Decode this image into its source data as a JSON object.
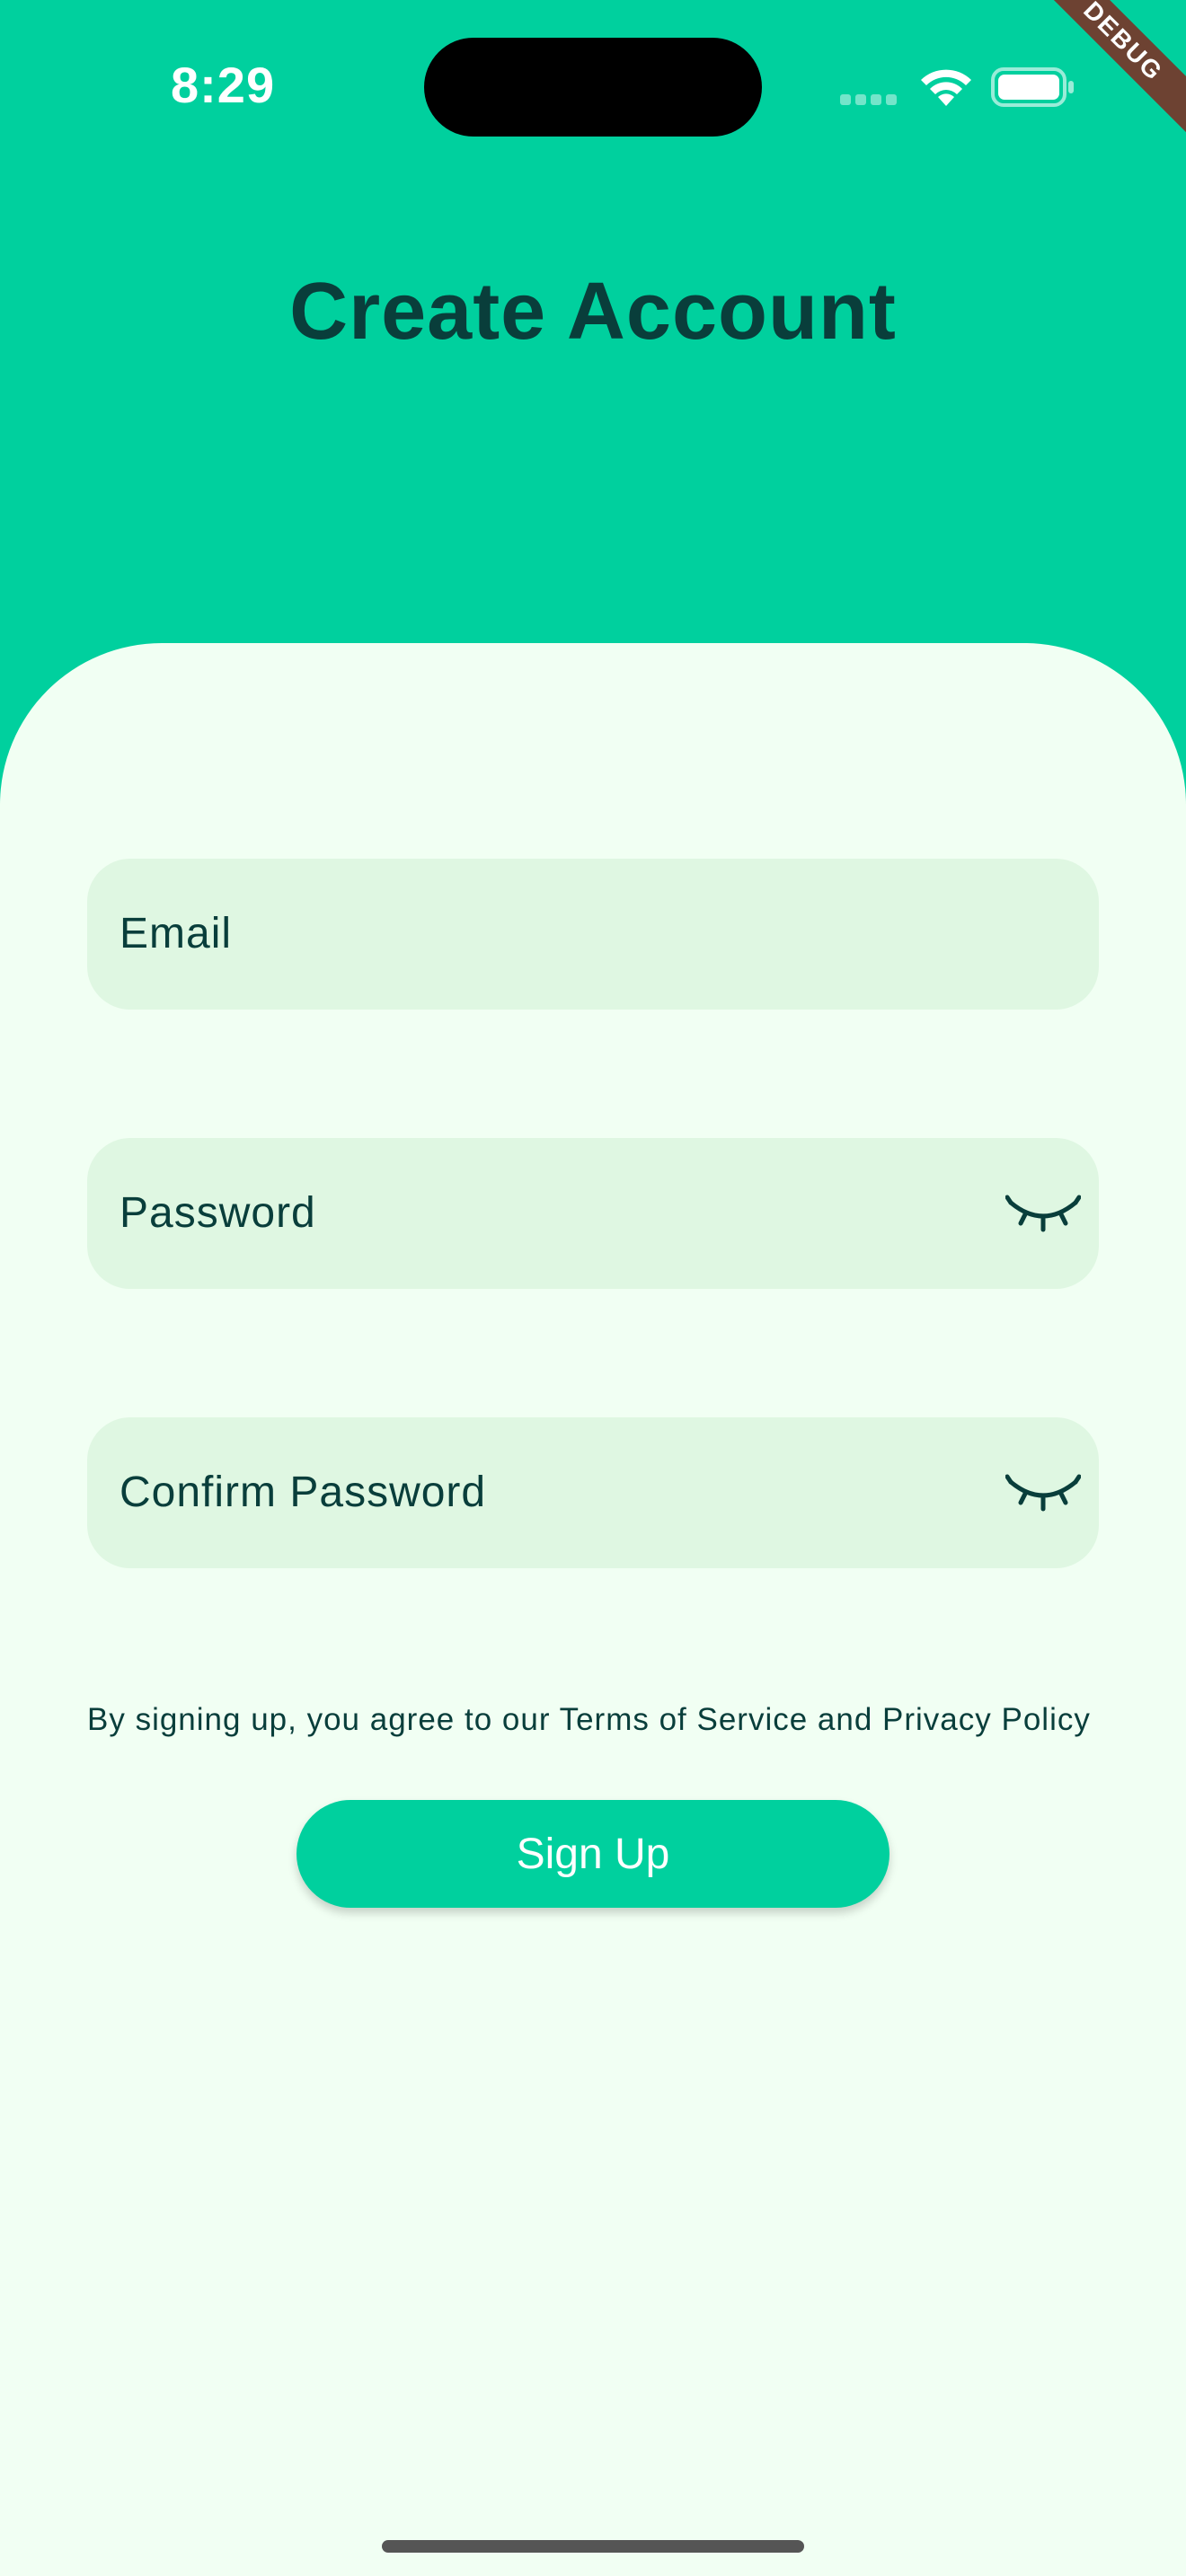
{
  "status_bar": {
    "time": "8:29"
  },
  "debug_banner": "DEBUG",
  "header": {
    "title": "Create Account"
  },
  "form": {
    "email_label": "Email",
    "password_label": "Password",
    "confirm_password_label": "Confirm Password",
    "terms_text": "By signing up, you agree to our Terms of Service and Privacy Policy",
    "signup_label": "Sign Up"
  },
  "colors": {
    "header_bg": "#00D09E",
    "panel_bg": "#F1FFF3",
    "field_bg": "#DFF7E2",
    "text_dark": "#093E3B",
    "button_bg": "#00D09E"
  },
  "icons": {
    "wifi": "wifi-icon",
    "battery": "battery-icon",
    "password_toggle": "eye-closed-icon"
  }
}
